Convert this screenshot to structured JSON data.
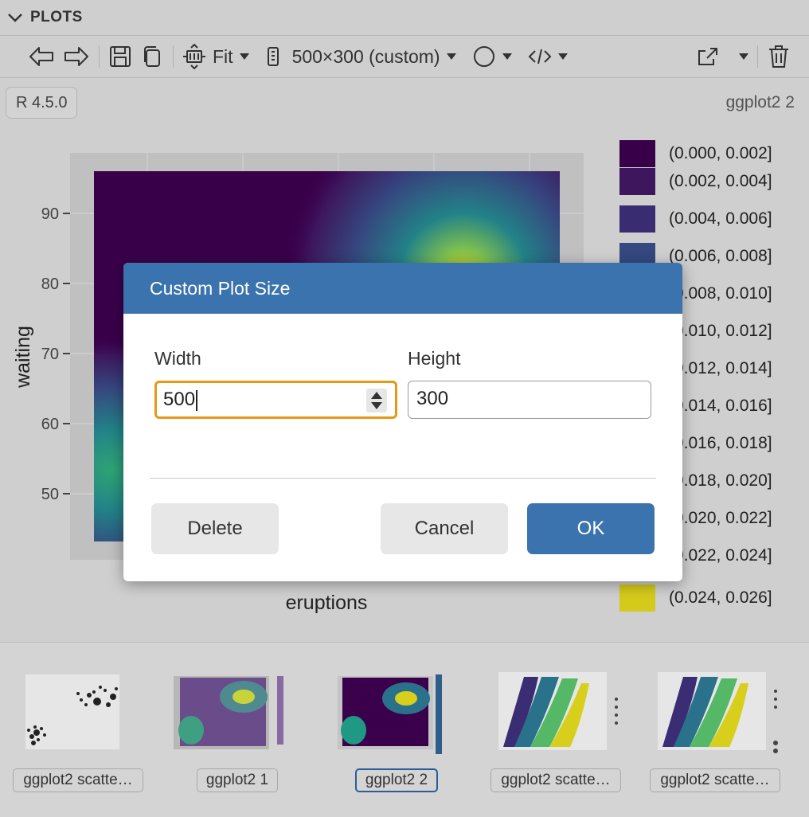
{
  "header": {
    "title": "PLOTS"
  },
  "toolbar": {
    "zoom_label": "Fit",
    "size_label": "500×300 (custom)"
  },
  "r_version": "R 4.5.0",
  "plot": {
    "name": "ggplot2 2",
    "y_label": "waiting",
    "x_label": "eruptions",
    "y_ticks": [
      "90",
      "80",
      "70",
      "60",
      "50"
    ],
    "legend": [
      {
        "label": "(0.000, 0.002]",
        "color": "#3b004c"
      },
      {
        "label": "(0.002, 0.004]",
        "color": "#3f1760"
      },
      {
        "label": "(0.004, 0.006]",
        "color": "#3b2d74"
      },
      {
        "label": "(0.006, 0.008]",
        "color": "#374a82"
      },
      {
        "label": "(0.008, 0.010]",
        "color": "#305e8a"
      },
      {
        "label": "(0.010, 0.012]",
        "color": "#2a728c"
      },
      {
        "label": "(0.012, 0.014]",
        "color": "#23858b"
      },
      {
        "label": "(0.014, 0.016]",
        "color": "#1f9884"
      },
      {
        "label": "(0.016, 0.018]",
        "color": "#2fa976"
      },
      {
        "label": "(0.018, 0.020]",
        "color": "#55b866"
      },
      {
        "label": "(0.020, 0.022]",
        "color": "#82c450"
      },
      {
        "label": "(0.022, 0.024]",
        "color": "#b2cd36"
      },
      {
        "label": "(0.024, 0.026]",
        "color": "#d8cf1c"
      }
    ]
  },
  "dialog": {
    "title": "Custom Plot Size",
    "width_label": "Width",
    "width_value": "500",
    "height_label": "Height",
    "height_value": "300",
    "delete_label": "Delete",
    "cancel_label": "Cancel",
    "ok_label": "OK"
  },
  "thumbnails": [
    {
      "caption": "ggplot2 scatte…",
      "selected": false
    },
    {
      "caption": "ggplot2 1",
      "selected": false
    },
    {
      "caption": "ggplot2 2",
      "selected": true
    },
    {
      "caption": "ggplot2 scatte…",
      "selected": false
    },
    {
      "caption": "ggplot2 scatte…",
      "selected": false
    }
  ],
  "colors": {
    "accent": "#3a73ad",
    "focus": "#e39a17"
  }
}
